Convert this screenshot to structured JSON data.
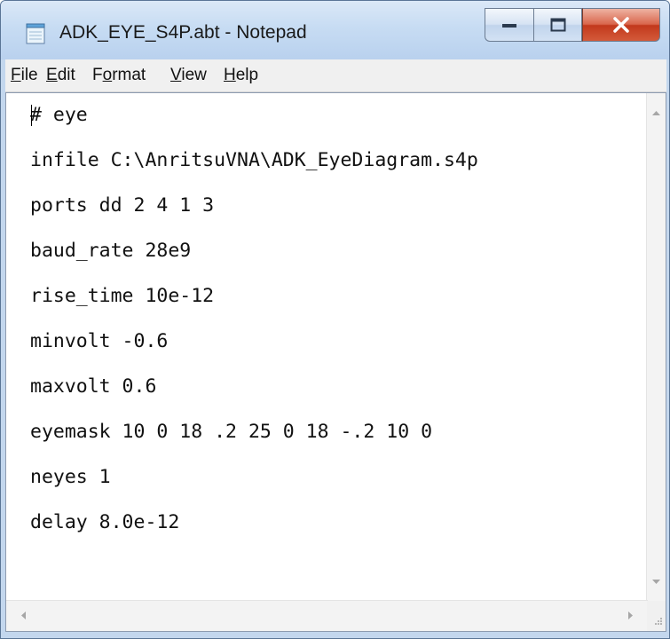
{
  "window": {
    "title": "ADK_EYE_S4P.abt - Notepad",
    "icon": "notepad-icon",
    "controls": [
      "minimize-icon",
      "maximize-icon",
      "close-icon"
    ]
  },
  "menu": {
    "items": [
      {
        "accel": "F",
        "rest": "ile"
      },
      {
        "accel": "E",
        "rest": "dit"
      },
      {
        "pre": "F",
        "accel": "o",
        "rest": "rmat"
      },
      {
        "accel": "V",
        "rest": "iew"
      },
      {
        "accel": "H",
        "rest": "elp"
      }
    ]
  },
  "editor": {
    "lines": [
      "# eye",
      "infile C:\\AnritsuVNA\\ADK_EyeDiagram.s4p",
      "ports dd 2 4 1 3",
      "baud_rate 28e9",
      "rise_time 10e-12",
      "minvolt -0.6",
      "maxvolt 0.6",
      "eyemask 10 0 18 .2 25 0 18 -.2 10 0",
      "neyes 1",
      "delay 8.0e-12"
    ]
  },
  "colors": {
    "titlebar": "#c7dcf3",
    "close_button": "#c2391c",
    "menubar": "#f0f0f0"
  }
}
